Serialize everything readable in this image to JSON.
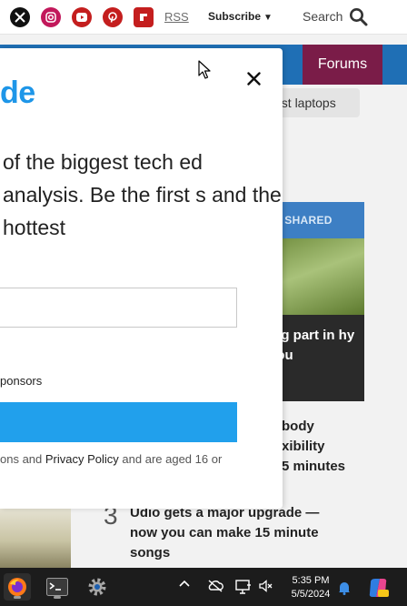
{
  "header": {
    "social_icons": [
      "x-icon",
      "instagram-icon",
      "youtube-icon",
      "pinterest-icon",
      "flipboard-icon"
    ],
    "rss_label": "RSS",
    "subscribe_label": "Subscribe",
    "search_label": "Search"
  },
  "nav": {
    "forums_label": "Forums"
  },
  "trending_chip": "est laptops",
  "card": {
    "header": "T SHARED",
    "title": "ing part in hy you"
  },
  "stories": {
    "story2": [
      "body",
      "xibility",
      "5 minutes"
    ],
    "story3_number": "3",
    "story3_title": "Udio gets a major upgrade — now you can make 15 minute songs"
  },
  "modal": {
    "brand": "de",
    "pitch": "of the biggest tech ed analysis. Be the first s and the hottest",
    "email_value": "",
    "consent_label": "ponsors",
    "signup_label": "",
    "terms_prefix": "ons and ",
    "privacy_link": "Privacy Policy",
    "terms_suffix": " and are aged 16 or"
  },
  "taskbar": {
    "time": "5:35 PM",
    "date": "5/5/2024"
  },
  "colors": {
    "brand_blue": "#1e96e8",
    "button_blue": "#21a0ec",
    "nav_blue": "#1f6fb5",
    "forums_maroon": "#7a1c48"
  }
}
